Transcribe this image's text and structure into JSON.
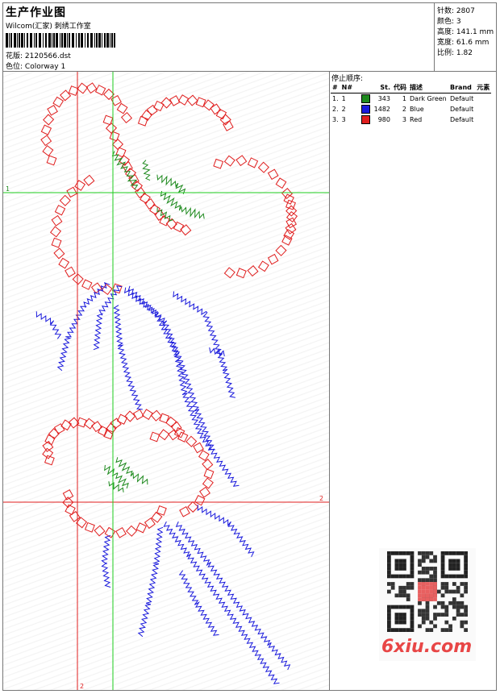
{
  "header": {
    "title": "生产作业图",
    "studio": "Wilcom(汇家) 刺绣工作室",
    "design_label": "花版:",
    "design_file": "2120566.dst",
    "colorway_label": "色位:",
    "colorway": "Colorway 1"
  },
  "stats": [
    {
      "label": "针数:",
      "value": "2807"
    },
    {
      "label": "颜色:",
      "value": "3"
    },
    {
      "label": "高度:",
      "value": "141.1 mm"
    },
    {
      "label": "宽度:",
      "value": "61.6 mm"
    },
    {
      "label": "比例:",
      "value": "1.82"
    }
  ],
  "stop_sequence": {
    "title": "停止顺序:",
    "columns": [
      "#",
      "N#",
      "St.",
      "代码",
      "描述",
      "Brand",
      "元素"
    ],
    "rows": [
      {
        "num": "1.",
        "n": "1",
        "color": "#1e8a1e",
        "stitches": "343",
        "code": "1",
        "desc": "Dark Green",
        "brand": "Default"
      },
      {
        "num": "2.",
        "n": "2",
        "color": "#1a1adc",
        "stitches": "1482",
        "code": "2",
        "desc": "Blue",
        "brand": "Default"
      },
      {
        "num": "3.",
        "n": "3",
        "color": "#e01e1e",
        "stitches": "980",
        "code": "3",
        "desc": "Red",
        "brand": "Default"
      }
    ]
  },
  "guides": {
    "h1_label": "1",
    "h2_label": "2",
    "v2_label": "2"
  },
  "watermark": {
    "logo": "6xiu.com"
  }
}
